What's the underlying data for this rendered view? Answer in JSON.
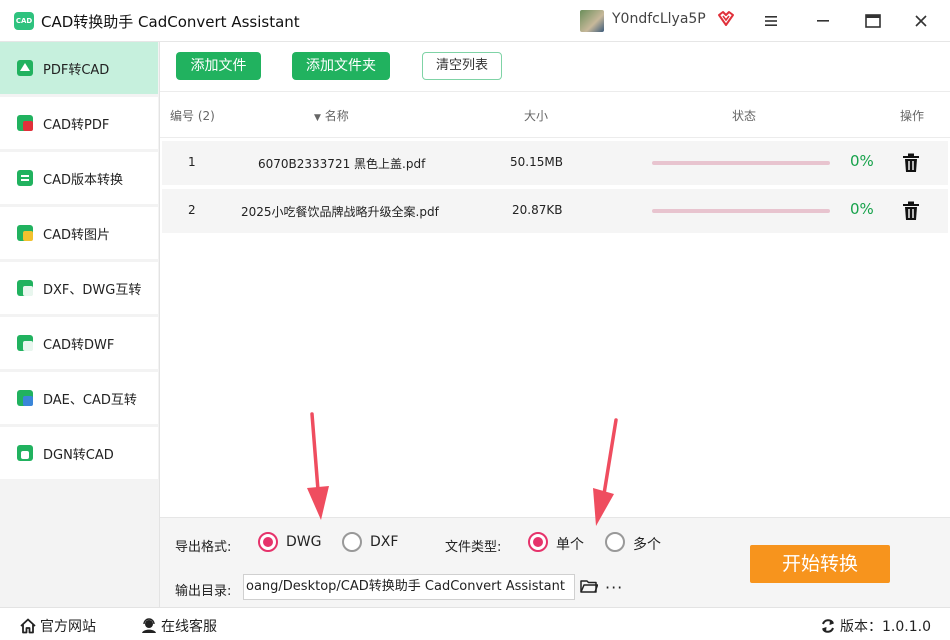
{
  "window": {
    "title": "CAD转换助手 CadConvert Assistant",
    "logo_text": "CAD",
    "username": "Y0ndfcLlya5P"
  },
  "sidebar": {
    "items": [
      {
        "label": "PDF转CAD",
        "active": true
      },
      {
        "label": "CAD转PDF"
      },
      {
        "label": "CAD版本转换"
      },
      {
        "label": "CAD转图片"
      },
      {
        "label": "DXF、DWG互转"
      },
      {
        "label": "CAD转DWF"
      },
      {
        "label": "DAE、CAD互转"
      },
      {
        "label": "DGN转CAD"
      }
    ]
  },
  "toolbar": {
    "add_file": "添加文件",
    "add_folder": "添加文件夹",
    "clear_list": "清空列表"
  },
  "table": {
    "headers": {
      "index": "编号 (2)",
      "name": "名称",
      "size": "大小",
      "status": "状态",
      "action": "操作"
    },
    "rows": [
      {
        "index": "1",
        "name": "6070B2333721 黑色上盖.pdf",
        "size": "50.15MB",
        "progress": 0,
        "percent": "0%"
      },
      {
        "index": "2",
        "name": "2025小吃餐饮品牌战略升级全案.pdf",
        "size": "20.87KB",
        "progress": 0,
        "percent": "0%"
      }
    ]
  },
  "options": {
    "format_label": "导出格式:",
    "formats": [
      {
        "label": "DWG",
        "checked": true
      },
      {
        "label": "DXF",
        "checked": false
      }
    ],
    "filetype_label": "文件类型:",
    "filetypes": [
      {
        "label": "单个",
        "checked": true
      },
      {
        "label": "多个",
        "checked": false
      }
    ],
    "output_label": "输出目录:",
    "output_path": "oang/Desktop/CAD转换助手 CadConvert Assistant",
    "more": "···",
    "start": "开始转换"
  },
  "footer": {
    "website": "官方网站",
    "support": "在线客服",
    "version": "版本：1.0.1.0"
  },
  "colors": {
    "accent_green": "#21b25f",
    "active_side": "#c6f0dd",
    "radio_pink": "#e6336b",
    "start_orange": "#f7941d",
    "percent_green": "#17a24b"
  }
}
